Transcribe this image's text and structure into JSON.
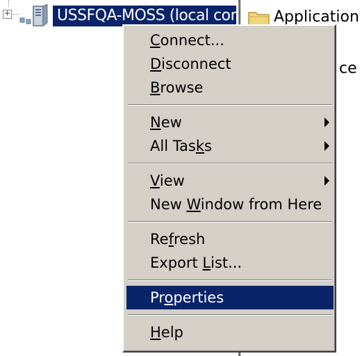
{
  "tree": {
    "expander_symbol": "+",
    "node_label": "USSFQA-MOSS (local comp"
  },
  "right_pane": {
    "items": [
      {
        "label": "Application Po",
        "icon": "folder-icon"
      },
      {
        "label": "ce"
      }
    ]
  },
  "context_menu": {
    "selected_color": "#0a246a",
    "groups": [
      {
        "items": [
          {
            "pre": "",
            "ul": "C",
            "post": "onnect..."
          },
          {
            "pre": "",
            "ul": "D",
            "post": "isconnect"
          },
          {
            "pre": "",
            "ul": "B",
            "post": "rowse"
          }
        ]
      },
      {
        "items": [
          {
            "pre": "",
            "ul": "N",
            "post": "ew",
            "submenu": true
          },
          {
            "pre": "All Tas",
            "ul": "k",
            "post": "s",
            "submenu": true
          }
        ]
      },
      {
        "items": [
          {
            "pre": "",
            "ul": "V",
            "post": "iew",
            "submenu": true
          },
          {
            "pre": "New ",
            "ul": "W",
            "post": "indow from Here"
          }
        ]
      },
      {
        "items": [
          {
            "pre": "Re",
            "ul": "f",
            "post": "resh"
          },
          {
            "pre": "Export ",
            "ul": "L",
            "post": "ist..."
          }
        ]
      },
      {
        "items": [
          {
            "pre": "Pr",
            "ul": "o",
            "post": "perties",
            "selected": true
          }
        ]
      },
      {
        "items": [
          {
            "pre": "",
            "ul": "H",
            "post": "elp"
          }
        ]
      }
    ]
  }
}
